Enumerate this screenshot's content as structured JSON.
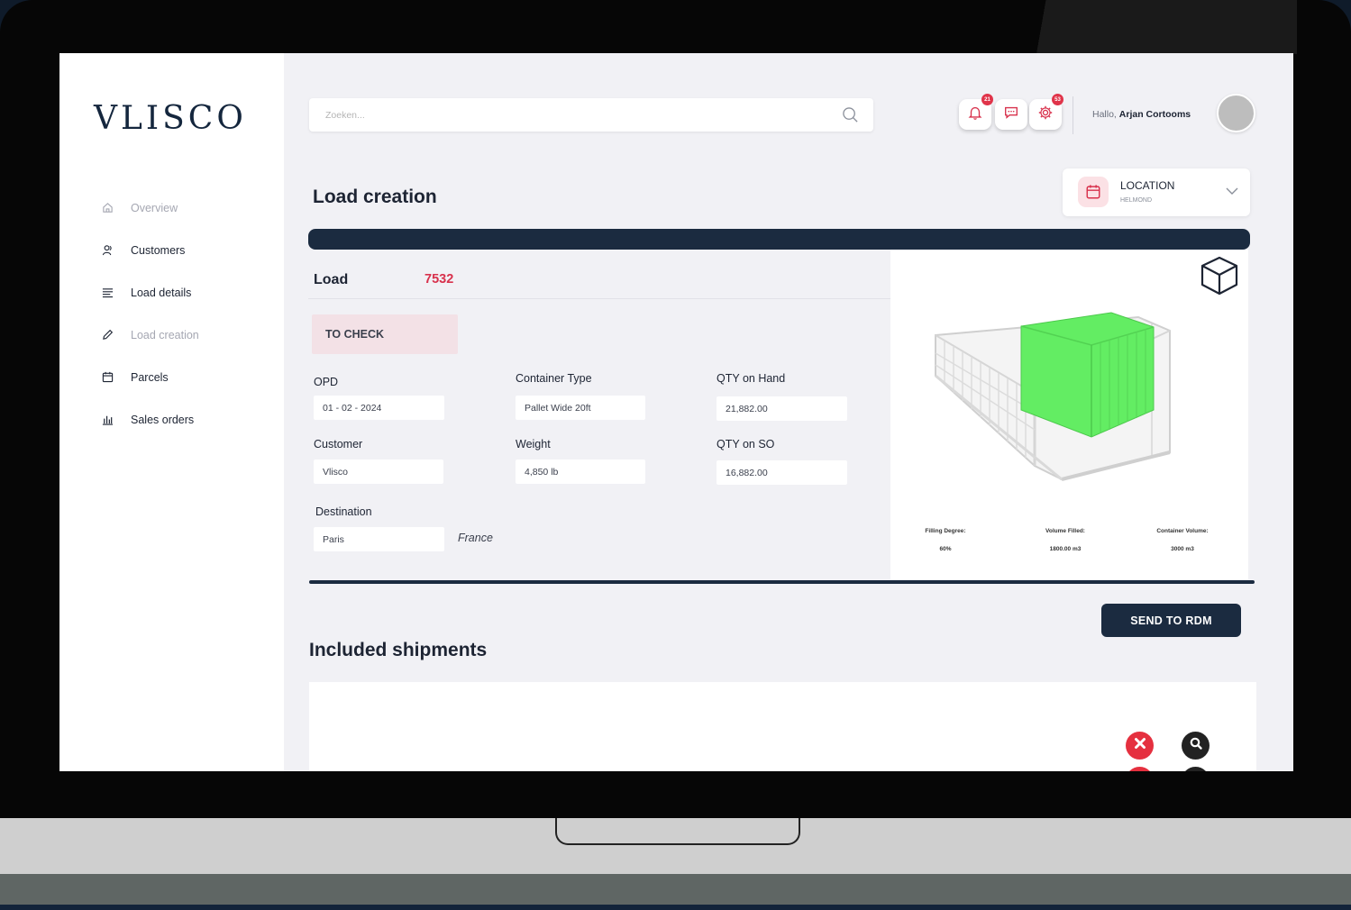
{
  "brand": {
    "logo_text": "VLISCO",
    "accent": "#d8314c",
    "navy": "#1b2b40"
  },
  "sidebar": {
    "items": [
      {
        "label": "Overview",
        "icon": "home-icon"
      },
      {
        "label": "Customers",
        "icon": "user-icon"
      },
      {
        "label": "Load details",
        "icon": "list-icon"
      },
      {
        "label": "Load creation",
        "icon": "pencil-icon"
      },
      {
        "label": "Parcels",
        "icon": "calendar-icon"
      },
      {
        "label": "Sales orders",
        "icon": "bar-chart-icon"
      }
    ]
  },
  "header": {
    "search_placeholder": "Zoeken...",
    "notifications_badge": "21",
    "settings_badge": "53",
    "greeting_prefix": "Hallo,",
    "user_name": "Arjan Cortooms"
  },
  "page": {
    "title": "Load creation"
  },
  "location": {
    "label": "LOCATION",
    "value": "HELMOND"
  },
  "load": {
    "label": "Load",
    "number": "7532",
    "status": "TO CHECK",
    "fields": {
      "opd": {
        "label": "OPD",
        "value": "01 - 02 - 2024"
      },
      "container_type": {
        "label": "Container Type",
        "value": "Pallet Wide 20ft"
      },
      "qty_on_hand": {
        "label": "QTY on Hand",
        "value": "21,882.00"
      },
      "customer": {
        "label": "Customer",
        "value": "Vlisco"
      },
      "weight": {
        "label": "Weight",
        "value": "4,850 lb"
      },
      "qty_on_so": {
        "label": "QTY on SO",
        "value": "16,882.00"
      },
      "destination": {
        "label": "Destination",
        "value": "Paris",
        "country": "France"
      }
    }
  },
  "visualization": {
    "filling_degree_label": "Filling Degree:",
    "filling_degree_value": "60%",
    "volume_filled_label": "Volume Filled:",
    "volume_filled_value": "1800.00 m3",
    "container_volume_label": "Container Volume:",
    "container_volume_value": "3000 m3",
    "fill_color": "#66ee66"
  },
  "actions": {
    "send_label": "SEND TO RDM"
  },
  "shipments": {
    "title": "Included shipments"
  }
}
